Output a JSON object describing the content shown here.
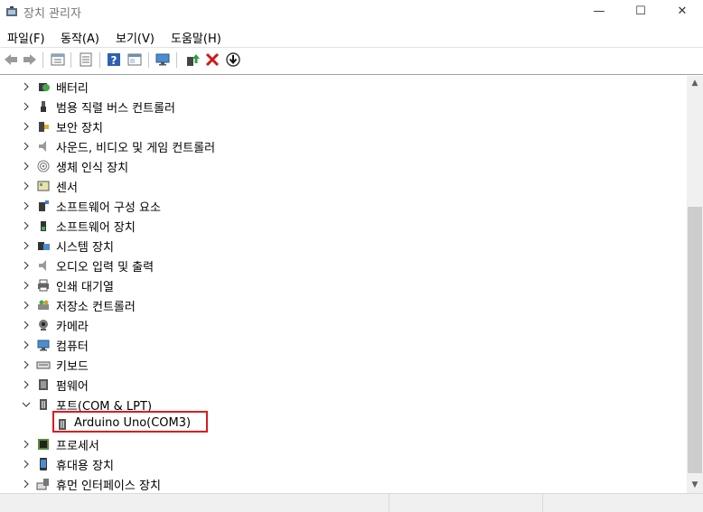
{
  "window": {
    "title": "장치 관리자",
    "min_glyph": "—",
    "max_glyph": "☐",
    "close_glyph": "✕"
  },
  "menu": [
    "파일(F)",
    "동작(A)",
    "보기(V)",
    "도움말(H)"
  ],
  "toolbar_icons": [
    "back-icon",
    "forward-icon",
    "properties-icon",
    "list-icon",
    "help-icon",
    "view-icon",
    "monitor-icon",
    "update-driver-icon",
    "uninstall-icon",
    "download-icon"
  ],
  "tree": [
    {
      "label": "배터리",
      "icon": "battery-icon",
      "expanded": false
    },
    {
      "label": "범용 직렬 버스 컨트롤러",
      "icon": "usb-icon",
      "expanded": false
    },
    {
      "label": "보안 장치",
      "icon": "security-icon",
      "expanded": false
    },
    {
      "label": "사운드, 비디오 및 게임 컨트롤러",
      "icon": "speaker-icon",
      "expanded": false
    },
    {
      "label": "생체 인식 장치",
      "icon": "fingerprint-icon",
      "expanded": false
    },
    {
      "label": "센서",
      "icon": "sensor-icon",
      "expanded": false
    },
    {
      "label": "소프트웨어 구성 요소",
      "icon": "software-component-icon",
      "expanded": false
    },
    {
      "label": "소프트웨어 장치",
      "icon": "software-device-icon",
      "expanded": false
    },
    {
      "label": "시스템 장치",
      "icon": "system-icon",
      "expanded": false
    },
    {
      "label": "오디오 입력 및 출력",
      "icon": "audio-icon",
      "expanded": false
    },
    {
      "label": "인쇄 대기열",
      "icon": "printer-icon",
      "expanded": false
    },
    {
      "label": "저장소 컨트롤러",
      "icon": "storage-icon",
      "expanded": false
    },
    {
      "label": "카메라",
      "icon": "camera-icon",
      "expanded": false
    },
    {
      "label": "컴퓨터",
      "icon": "computer-icon",
      "expanded": false
    },
    {
      "label": "키보드",
      "icon": "keyboard-icon",
      "expanded": false
    },
    {
      "label": "펌웨어",
      "icon": "firmware-icon",
      "expanded": false
    },
    {
      "label": "포트(COM & LPT)",
      "icon": "port-icon",
      "expanded": true,
      "children": [
        {
          "label": "Arduino Uno(COM3)",
          "icon": "port-icon",
          "highlighted": true
        }
      ]
    },
    {
      "label": "프로세서",
      "icon": "processor-icon",
      "expanded": false
    },
    {
      "label": "휴대용 장치",
      "icon": "portable-device-icon",
      "expanded": false
    },
    {
      "label": "휴먼 인터페이스 장치",
      "icon": "hid-icon",
      "expanded": false
    }
  ],
  "colors": {
    "highlight_border": "#e0191f",
    "scrollbar_thumb": "#cdcdcd"
  }
}
